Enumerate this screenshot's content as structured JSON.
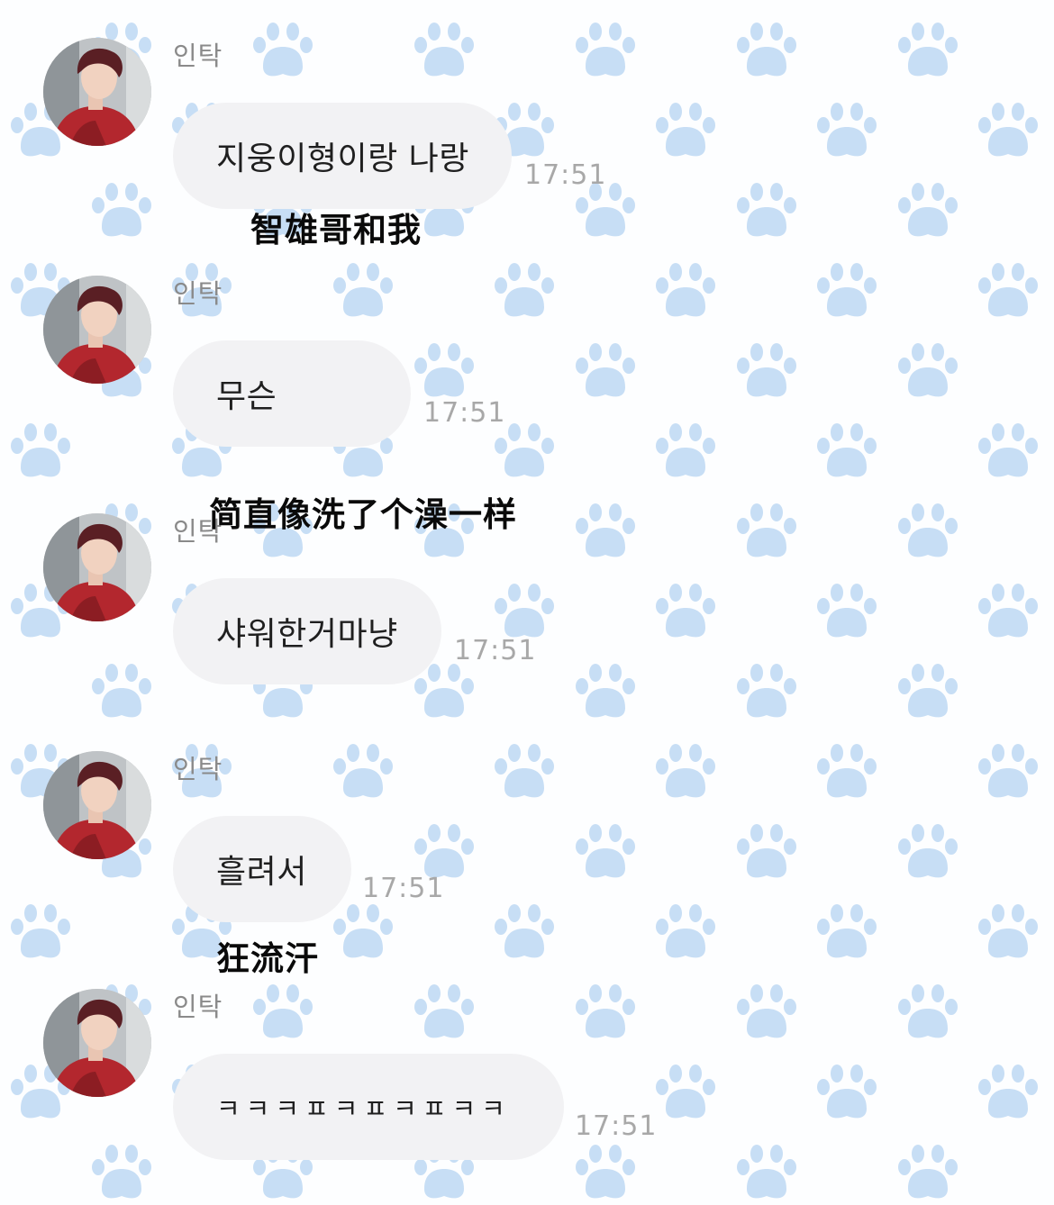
{
  "chat": {
    "background_color": "#fdfeff",
    "pattern_icon": "paw-icon",
    "pattern_color": "#c7def5",
    "bubble_color": "#f2f2f4",
    "messages": [
      {
        "sender": "인탁",
        "text": "지웅이형이랑 나랑",
        "time": "17:51",
        "translation": "智雄哥和我"
      },
      {
        "sender": "인탁",
        "text": "무슨",
        "time": "17:51",
        "translation": "简直像洗了个澡一样"
      },
      {
        "sender": "인탁",
        "text": "샤워한거마냥",
        "time": "17:51"
      },
      {
        "sender": "인탁",
        "text": "흘려서",
        "time": "17:51",
        "translation": "狂流汗"
      },
      {
        "sender": "인탁",
        "text": "ㅋㅋㅋㅍㅋㅍㅋㅍㅋㅋ",
        "time": "17:51"
      }
    ]
  }
}
